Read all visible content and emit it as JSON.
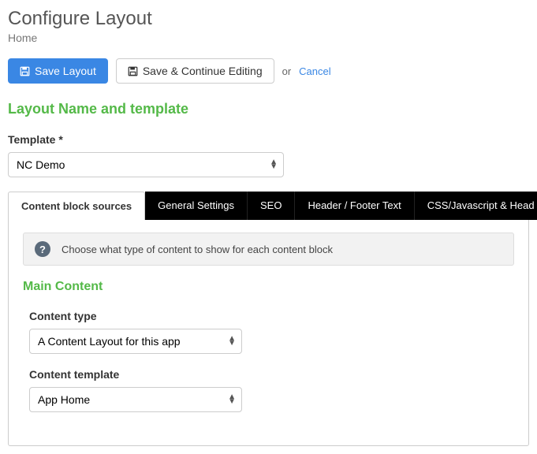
{
  "header": {
    "title": "Configure Layout",
    "subtitle": "Home"
  },
  "actions": {
    "save": "Save Layout",
    "saveContinue": "Save & Continue Editing",
    "or": "or",
    "cancel": "Cancel"
  },
  "section": {
    "heading": "Layout Name and template"
  },
  "templateField": {
    "label": "Template *",
    "value": "NC Demo"
  },
  "tabs": {
    "t0": "Content block sources",
    "t1": "General Settings",
    "t2": "SEO",
    "t3": "Header / Footer Text",
    "t4": "CSS/Javascript & Head Content"
  },
  "info": {
    "text": "Choose what type of content to show for each content block"
  },
  "mainContent": {
    "heading": "Main Content",
    "contentType": {
      "label": "Content type",
      "value": "A Content Layout for this app"
    },
    "contentTemplate": {
      "label": "Content template",
      "value": "App Home"
    }
  }
}
